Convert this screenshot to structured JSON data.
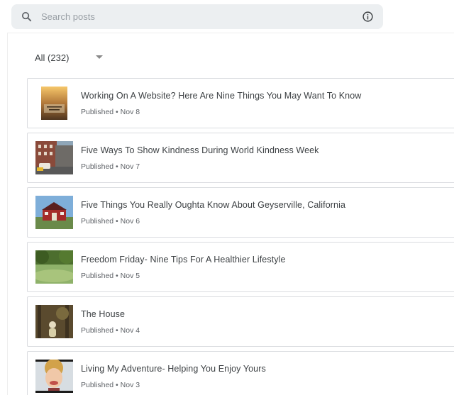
{
  "search": {
    "placeholder": "Search posts"
  },
  "filter": {
    "label": "All (232)"
  },
  "posts": [
    {
      "title": "Working On A Website? Here Are Nine Things You May Want To Know",
      "status": "Published",
      "date": "Nov 8",
      "thumbnail": "book-cover"
    },
    {
      "title": "Five Ways To Show Kindness During World Kindness Week",
      "status": "Published",
      "date": "Nov 7",
      "thumbnail": "city-street"
    },
    {
      "title": "Five Things You Really Oughta Know About Geyserville, California",
      "status": "Published",
      "date": "Nov 6",
      "thumbnail": "red-barn"
    },
    {
      "title": "Freedom Friday- Nine Tips For A Healthier Lifestyle",
      "status": "Published",
      "date": "Nov 5",
      "thumbnail": "green-park"
    },
    {
      "title": "The House",
      "status": "Published",
      "date": "Nov 4",
      "thumbnail": "forest-figure"
    },
    {
      "title": "Living My Adventure- Helping You Enjoy Yours",
      "status": "Published",
      "date": "Nov 3",
      "thumbnail": "smiling-face"
    }
  ]
}
